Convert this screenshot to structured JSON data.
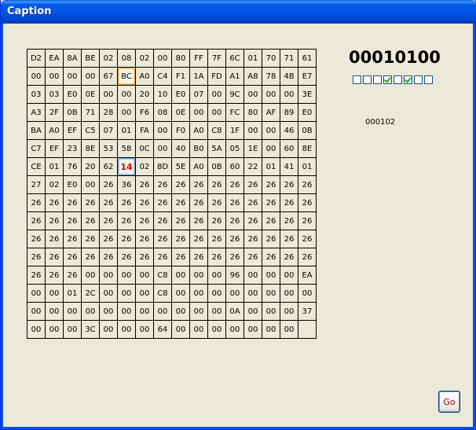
{
  "window": {
    "title": "Caption"
  },
  "hex_grid": {
    "rows": [
      [
        "D2",
        "EA",
        "8A",
        "BE",
        "02",
        "08",
        "02",
        "00",
        "80",
        "FF",
        "7F",
        "6C",
        "01",
        "70",
        "71",
        "61"
      ],
      [
        "00",
        "00",
        "00",
        "00",
        "67",
        "BC",
        "A0",
        "C4",
        "F1",
        "1A",
        "FD",
        "A1",
        "A8",
        "78",
        "4B",
        "E7"
      ],
      [
        "03",
        "03",
        "E0",
        "0E",
        "00",
        "00",
        "20",
        "10",
        "E0",
        "07",
        "00",
        "9C",
        "00",
        "00",
        "00",
        "3E"
      ],
      [
        "A3",
        "2F",
        "0B",
        "71",
        "28",
        "00",
        "F6",
        "08",
        "0E",
        "00",
        "00",
        "FC",
        "80",
        "AF",
        "89",
        "E0"
      ],
      [
        "BA",
        "A0",
        "EF",
        "C5",
        "07",
        "01",
        "FA",
        "00",
        "F0",
        "A0",
        "C8",
        "1F",
        "00",
        "00",
        "46",
        "0B"
      ],
      [
        "C7",
        "EF",
        "23",
        "8E",
        "53",
        "58",
        "0C",
        "00",
        "40",
        "B0",
        "5A",
        "05",
        "1E",
        "00",
        "60",
        "8E"
      ],
      [
        "CE",
        "01",
        "76",
        "20",
        "62",
        "14",
        "02",
        "8D",
        "5E",
        "A0",
        "0B",
        "60",
        "22",
        "01",
        "41",
        "01"
      ],
      [
        "27",
        "02",
        "E0",
        "00",
        "26",
        "36",
        "26",
        "26",
        "26",
        "26",
        "26",
        "26",
        "26",
        "26",
        "26",
        "26"
      ],
      [
        "26",
        "26",
        "26",
        "26",
        "26",
        "26",
        "26",
        "26",
        "26",
        "26",
        "26",
        "26",
        "26",
        "26",
        "26",
        "26"
      ],
      [
        "26",
        "26",
        "26",
        "26",
        "26",
        "26",
        "26",
        "26",
        "26",
        "26",
        "26",
        "26",
        "26",
        "26",
        "26",
        "26"
      ],
      [
        "26",
        "26",
        "26",
        "26",
        "26",
        "26",
        "26",
        "26",
        "26",
        "26",
        "26",
        "26",
        "26",
        "26",
        "26",
        "26"
      ],
      [
        "26",
        "26",
        "26",
        "26",
        "26",
        "26",
        "26",
        "26",
        "26",
        "26",
        "26",
        "26",
        "26",
        "26",
        "26",
        "26"
      ],
      [
        "26",
        "26",
        "26",
        "00",
        "00",
        "00",
        "00",
        "C8",
        "00",
        "00",
        "00",
        "96",
        "00",
        "00",
        "00",
        "EA"
      ],
      [
        "00",
        "00",
        "01",
        "2C",
        "00",
        "00",
        "00",
        "C8",
        "00",
        "00",
        "00",
        "00",
        "00",
        "00",
        "00",
        "00"
      ],
      [
        "00",
        "00",
        "00",
        "00",
        "00",
        "00",
        "00",
        "00",
        "00",
        "00",
        "00",
        "0A",
        "00",
        "00",
        "00",
        "37"
      ],
      [
        "00",
        "00",
        "00",
        "3C",
        "00",
        "00",
        "00",
        "64",
        "00",
        "00",
        "00",
        "00",
        "00",
        "00",
        "00",
        ""
      ]
    ],
    "selected_cell": {
      "row": 6,
      "col": 5
    },
    "hover_cell": {
      "row": 1,
      "col": 5
    }
  },
  "binary_display": "00010100",
  "bit_checkboxes": [
    false,
    false,
    false,
    true,
    false,
    true,
    false,
    false
  ],
  "offset_label": "000102",
  "go_button_label": "Go"
}
